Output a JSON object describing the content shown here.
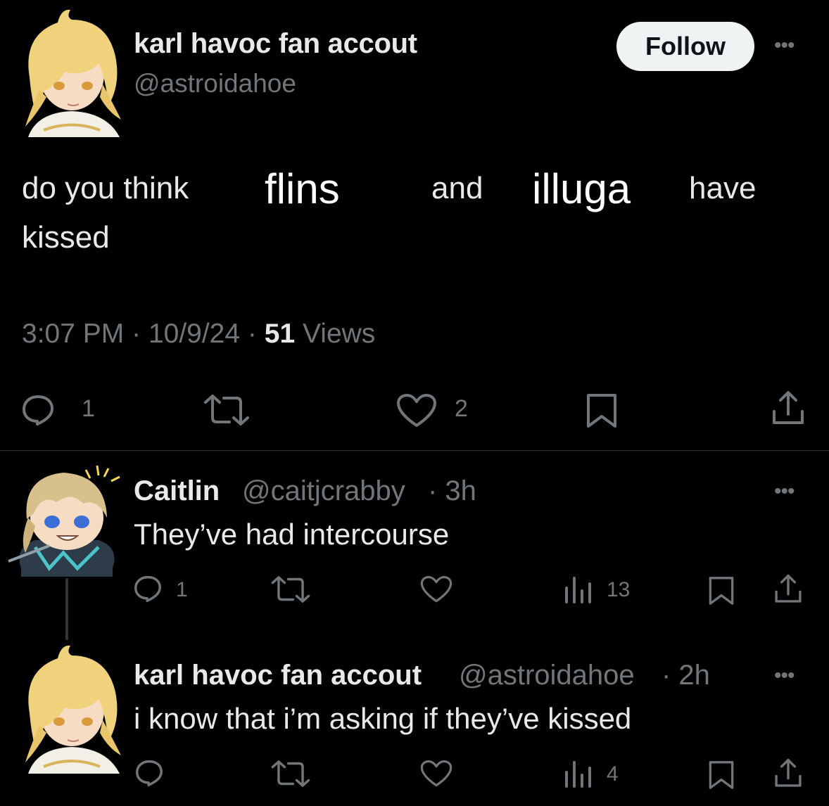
{
  "main_post": {
    "display_name": "karl havoc fan accout",
    "handle": "@astroidahoe",
    "follow_label": "Follow",
    "more_label": "•••",
    "text": {
      "part1": "do you think",
      "word1": "flins",
      "part2": "and",
      "word2": "illuga",
      "part3": "have",
      "part4": "kissed"
    },
    "time": "3:07 PM",
    "date": "10/9/24",
    "separator": "·",
    "views_count": "51",
    "views_label": "Views",
    "replies": "1",
    "likes": "2",
    "icons": [
      "reply-icon",
      "retweet-icon",
      "like-icon",
      "bookmark-icon",
      "share-icon"
    ]
  },
  "replies": [
    {
      "display_name": "Caitlin",
      "handle": "@caitjcrabby",
      "time": "· 3h",
      "text": "They’ve had intercourse",
      "replies": "1",
      "views": "13",
      "more_label": "•••"
    },
    {
      "display_name": "karl havoc fan accout",
      "handle": "@astroidahoe",
      "time": "· 2h",
      "text": "i know that i’m asking if they’ve kissed",
      "views": "4",
      "more_label": "•••"
    }
  ],
  "colors": {
    "background": "#000000",
    "primary_text": "#e7e9ea",
    "secondary_text": "#71767b",
    "follow_bg": "#eff3f4",
    "divider": "#2f3336"
  }
}
